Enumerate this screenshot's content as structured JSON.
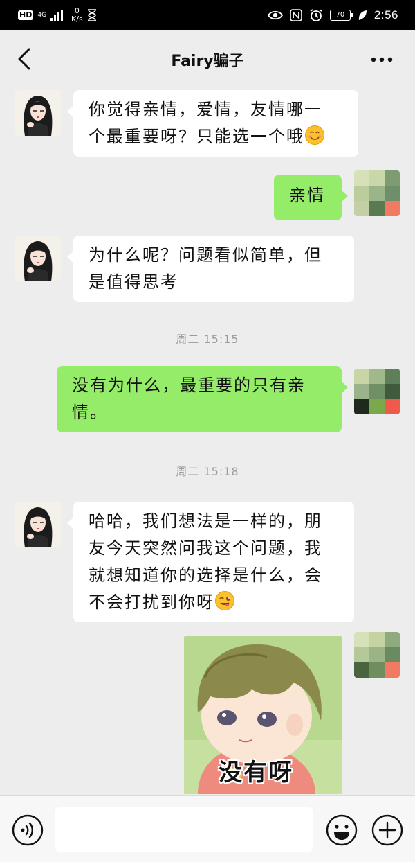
{
  "status_bar": {
    "hd": "HD",
    "network": "4G",
    "speed_value": "0",
    "speed_unit": "K/s",
    "battery": "70",
    "time": "2:56"
  },
  "header": {
    "title": "Fairy骗子",
    "back_icon": "chevron-left-icon",
    "more_icon": "more-dots-icon"
  },
  "messages": [
    {
      "side": "left",
      "text": "你觉得亲情，爱情，友情哪一个最重要呀？只能选一个哦",
      "emoji": "smile-emoji"
    },
    {
      "side": "right",
      "text": "亲情"
    },
    {
      "side": "left",
      "text": "为什么呢？问题看似简单，但是值得思考"
    },
    {
      "type": "timestamp",
      "text": "周二 15:15"
    },
    {
      "side": "right",
      "text": "没有为什么，最重要的只有亲情。"
    },
    {
      "type": "timestamp",
      "text": "周二 15:18"
    },
    {
      "side": "left",
      "text": "哈哈，我们想法是一样的，朋友今天突然问我这个问题，我就想知道你的选择是什么，会不会打扰到你呀",
      "emoji": "wink-tongue-emoji"
    },
    {
      "side": "right",
      "type": "sticker",
      "text": "没有呀"
    }
  ],
  "msg_lines": {
    "m1_l1": "你觉得亲情，爱情，友情哪一",
    "m1_l2": "个最重要呀？只能选一个哦",
    "m2": "亲情",
    "m3_l1": "为什么呢？问题看似简单，但",
    "m3_l2": "是值得思考",
    "ts1": "周二 15:15",
    "m4_l1": "没有为什么，最重要的只有亲",
    "m4_l2": "情。",
    "ts2": "周二 15:18",
    "m5_l1": "哈哈，我们想法是一样的，朋",
    "m5_l2": "友今天突然问我这个问题，我",
    "m5_l3": "就想知道你的选择是什么，会",
    "m5_l4": "不会打扰到你呀",
    "sticker_caption": "没有呀"
  },
  "colors": {
    "background": "#ededed",
    "bubble_right": "#95ec69",
    "bubble_left": "#ffffff",
    "timestamp": "#9a9a9a"
  },
  "input_bar": {
    "voice_icon": "voice-icon",
    "text_value": "",
    "emoji_icon": "emoji-icon",
    "plus_icon": "plus-icon"
  }
}
